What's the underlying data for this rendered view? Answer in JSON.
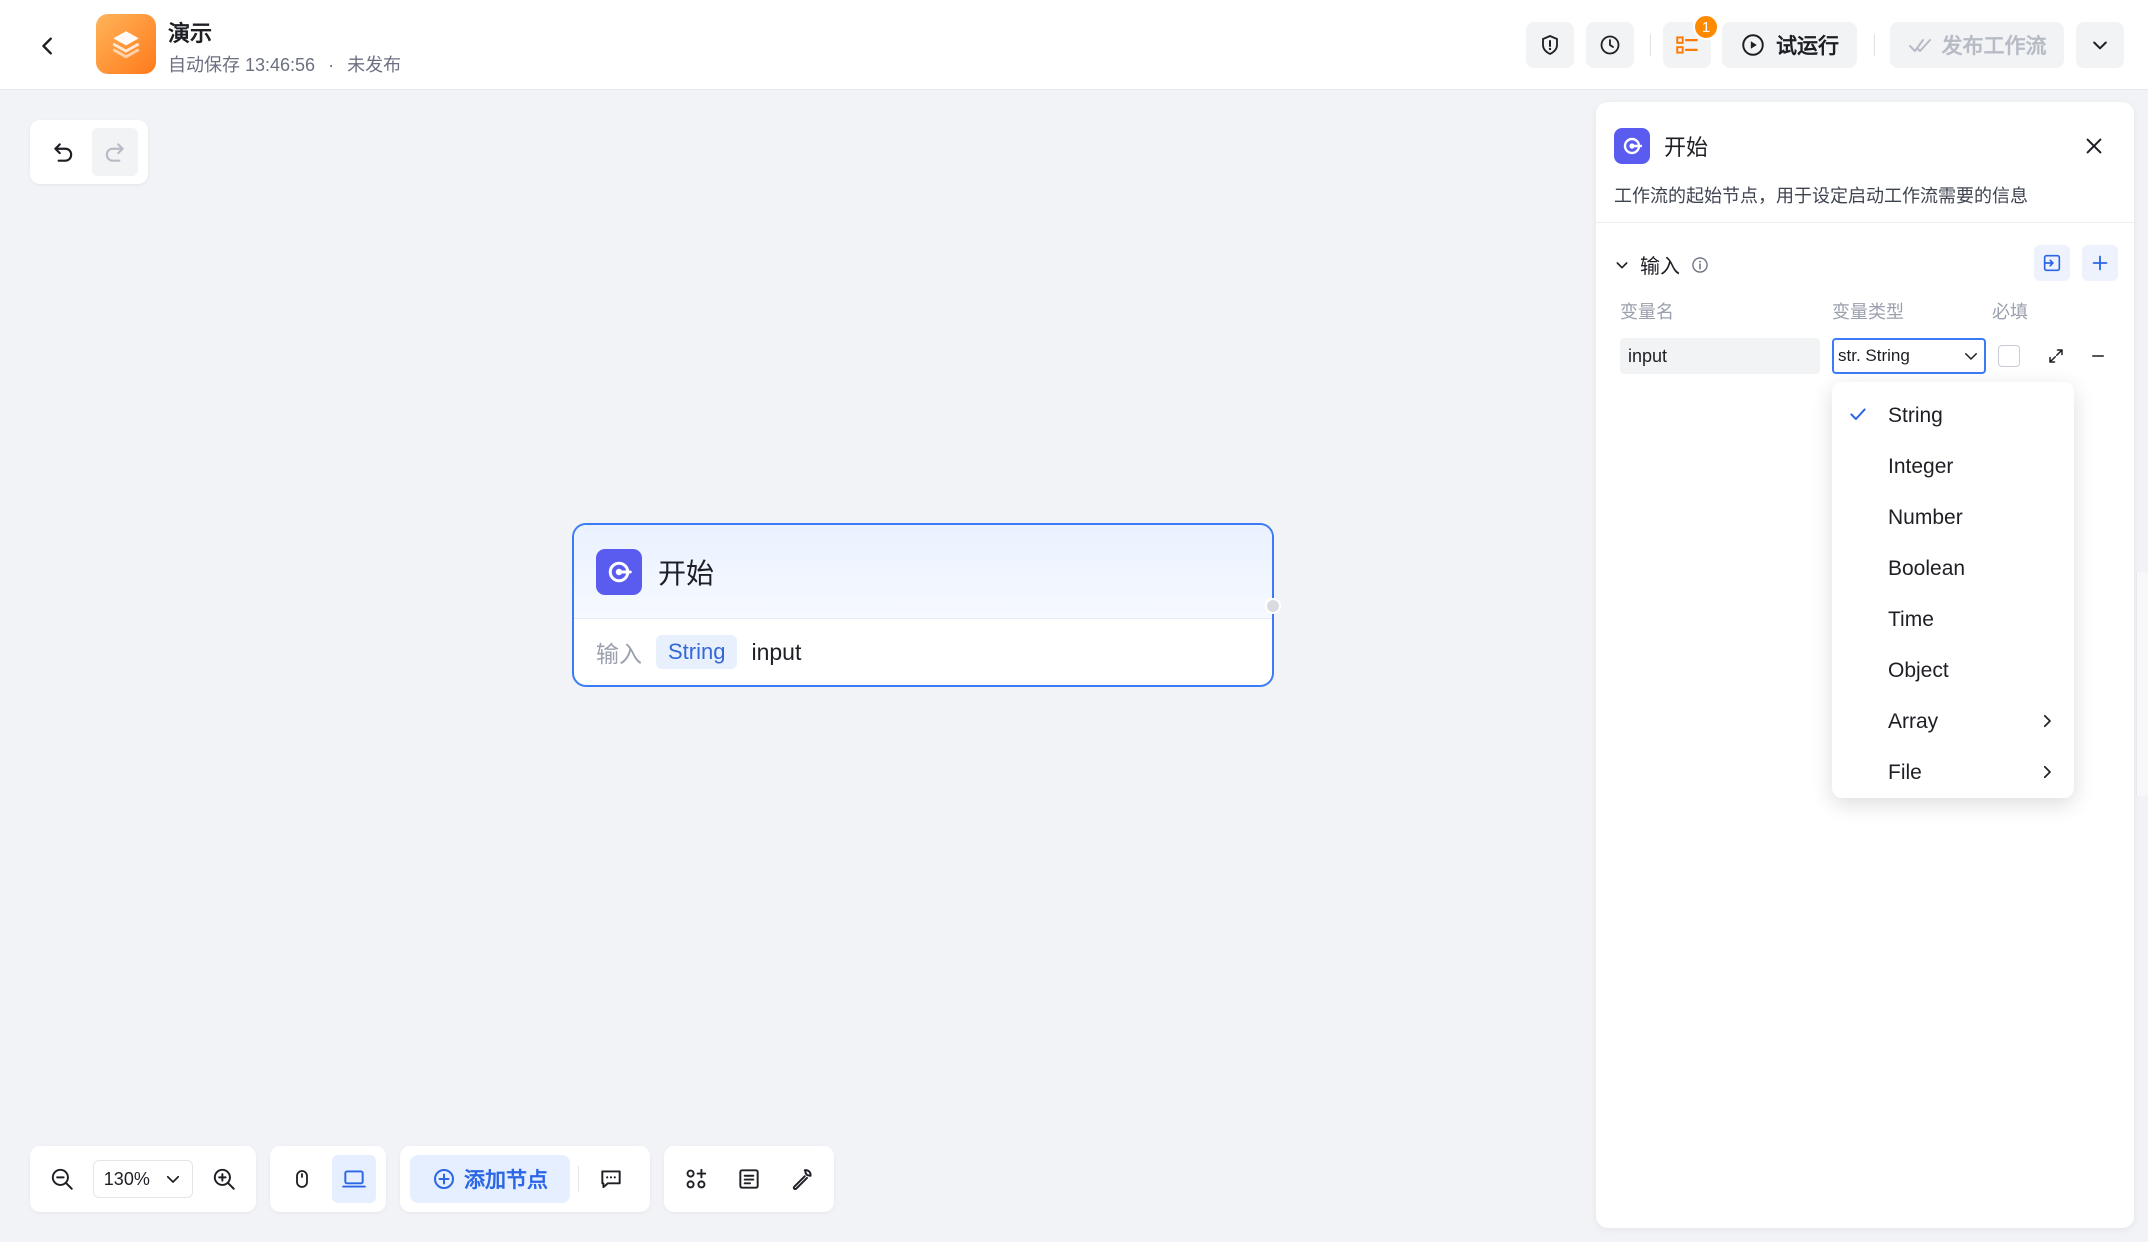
{
  "header": {
    "title": "演示",
    "autosave": "自动保存 13:46:56",
    "dot": "·",
    "publish_status": "未发布",
    "badge_count": "1",
    "test_run_label": "试运行",
    "publish_label": "发布工作流"
  },
  "canvas": {
    "node": {
      "title": "开始",
      "input_label": "输入",
      "var_type": "String",
      "var_name": "input"
    }
  },
  "bottom_toolbar": {
    "zoom": "130%",
    "add_node_label": "添加节点"
  },
  "panel": {
    "title": "开始",
    "description": "工作流的起始节点，用于设定启动工作流需要的信息",
    "section_title": "输入",
    "columns": [
      "变量名",
      "变量类型",
      "必填"
    ],
    "row": {
      "name": "input",
      "type_prefix": "str.",
      "type": "String"
    }
  },
  "type_dropdown": {
    "items": [
      {
        "label": "String",
        "selected": true,
        "submenu": false
      },
      {
        "label": "Integer",
        "selected": false,
        "submenu": false
      },
      {
        "label": "Number",
        "selected": false,
        "submenu": false
      },
      {
        "label": "Boolean",
        "selected": false,
        "submenu": false
      },
      {
        "label": "Time",
        "selected": false,
        "submenu": false
      },
      {
        "label": "Object",
        "selected": false,
        "submenu": false
      },
      {
        "label": "Array",
        "selected": false,
        "submenu": true
      },
      {
        "label": "File",
        "selected": false,
        "submenu": true
      }
    ]
  },
  "colors": {
    "accent": "#3b7cf6",
    "node_icon": "#5a5cf0",
    "app_logo": "#ff8a1f",
    "badge": "#ff8a00"
  }
}
